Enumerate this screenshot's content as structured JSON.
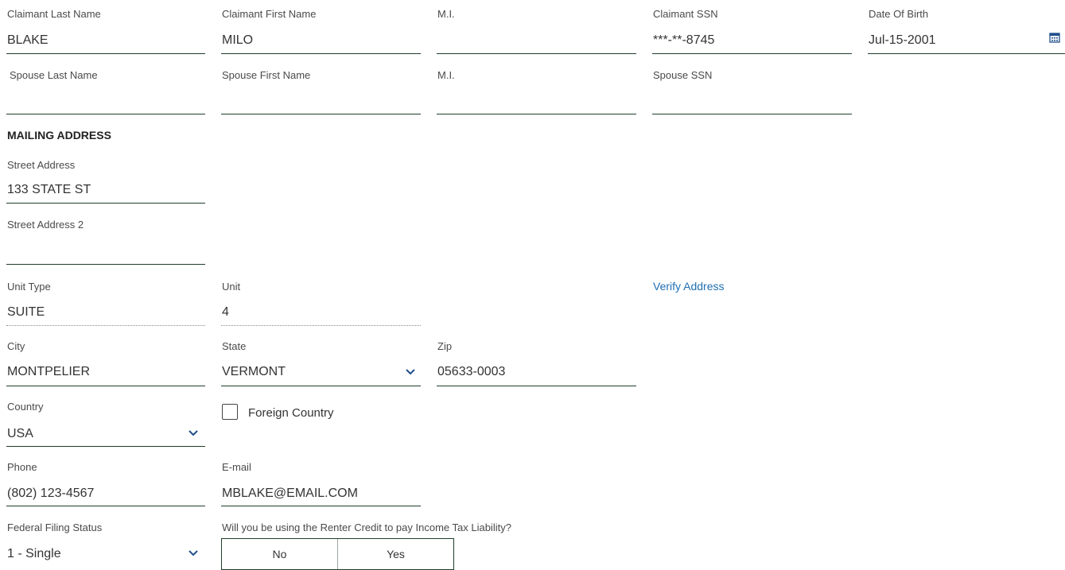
{
  "claimant": {
    "last_name_label": "Claimant Last Name",
    "last_name": "BLAKE",
    "first_name_label": "Claimant First Name",
    "first_name": "MILO",
    "mi_label": "M.I.",
    "mi": "",
    "ssn_label": "Claimant SSN",
    "ssn": "***-**-8745",
    "dob_label": "Date Of Birth",
    "dob": "Jul-15-2001"
  },
  "spouse": {
    "last_name_label": "Spouse Last Name",
    "last_name": "",
    "first_name_label": "Spouse First Name",
    "first_name": "",
    "mi_label": "M.I.",
    "mi": "",
    "ssn_label": "Spouse SSN",
    "ssn": ""
  },
  "mailing": {
    "section_title": "MAILING ADDRESS",
    "street_label": "Street Address",
    "street": "133 STATE ST",
    "street2_label": "Street Address 2",
    "street2": "",
    "unit_type_label": "Unit Type",
    "unit_type": "SUITE",
    "unit_label": "Unit",
    "unit": "4",
    "verify_link": "Verify Address",
    "city_label": "City",
    "city": "MONTPELIER",
    "state_label": "State",
    "state": "VERMONT",
    "zip_label": "Zip",
    "zip": "05633-0003",
    "country_label": "Country",
    "country": "USA",
    "foreign_country_label": "Foreign Country",
    "foreign_country_checked": false
  },
  "contact": {
    "phone_label": "Phone",
    "phone": "(802) 123-4567",
    "email_label": "E-mail",
    "email": "MBLAKE@EMAIL.COM"
  },
  "filing": {
    "status_label": "Federal Filing Status",
    "status": "1 - Single",
    "renter_credit_question": "Will you be using the Renter Credit to pay Income Tax Liability?",
    "options": [
      "No",
      "Yes"
    ]
  },
  "colors": {
    "underline": "#1f3d2a",
    "link": "#1f6fb2",
    "chevron": "#1f4f8a"
  },
  "icons": {
    "calendar": "calendar-icon",
    "dropdown": "chevron-down-icon"
  }
}
